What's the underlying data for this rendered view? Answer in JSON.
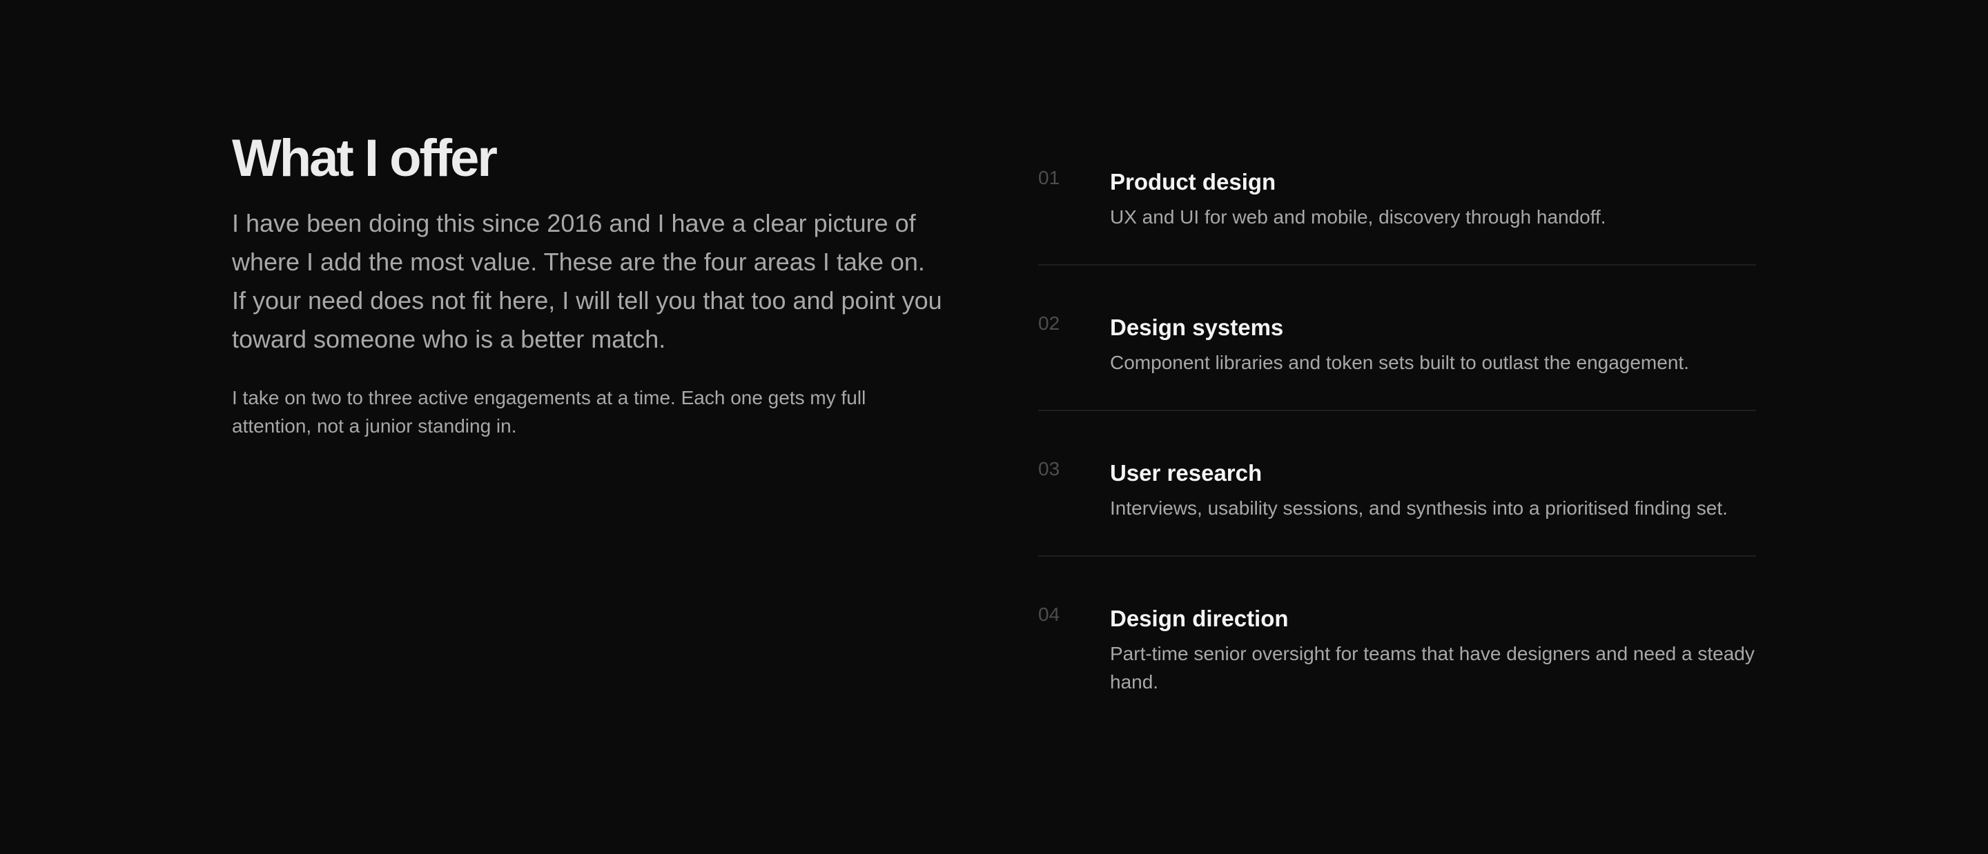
{
  "intro": {
    "title": "What I offer",
    "lead": "I have been doing this since 2016 and I have a clear picture of where I add the most value. These are the four areas I take on. If your need does not fit here, I will tell you that too and point you toward someone who is a better match.",
    "note": "I take on two to three active engagements at a time. Each one gets my full attention, not a junior standing in."
  },
  "services": [
    {
      "number": "01",
      "name": "Product design",
      "description": "UX and UI for web and mobile, discovery through handoff."
    },
    {
      "number": "02",
      "name": "Design systems",
      "description": "Component libraries and token sets built to outlast the engagement."
    },
    {
      "number": "03",
      "name": "User research",
      "description": "Interviews, usability sessions, and synthesis into a prioritised finding set."
    },
    {
      "number": "04",
      "name": "Design direction",
      "description": "Part-time senior oversight for teams that have designers and need a steady hand."
    }
  ],
  "colors": {
    "background": "#0b0b0b",
    "title": "#ececec",
    "body_text": "#a8a8a8",
    "number": "#4d4d4d",
    "divider": "#1f1f1f"
  }
}
